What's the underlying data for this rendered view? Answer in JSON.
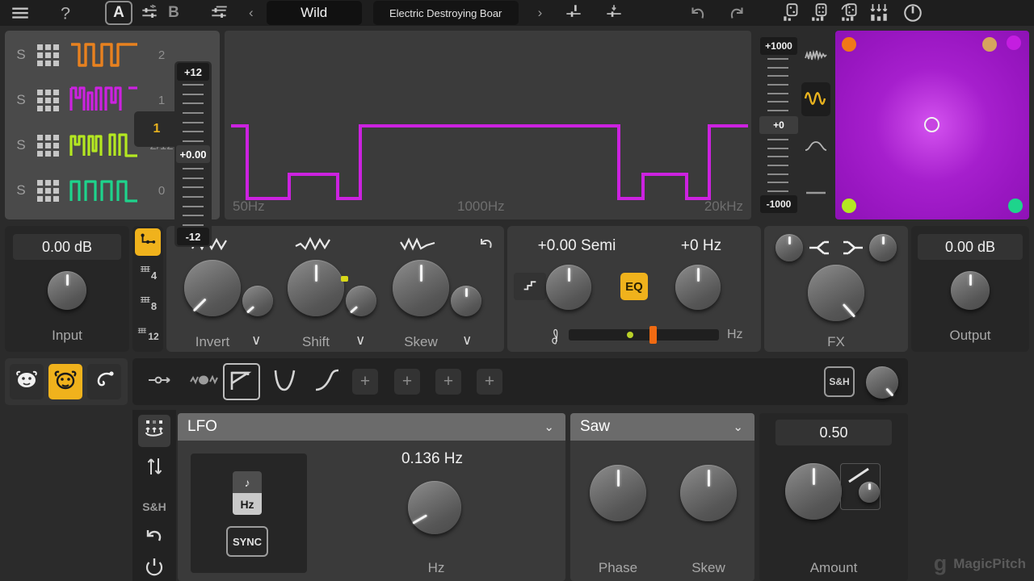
{
  "header": {
    "menu_icon": "hamburger-icon",
    "help_icon": "question-mark-icon",
    "a_label": "A",
    "b_label": "B",
    "copy_a_to_b_icon": "sliders-copy-icon",
    "copy_b_to_a_icon": "sliders-copy-icon",
    "prev_preset_icon": "chevron-left-icon",
    "next_preset_icon": "chevron-right-icon",
    "preset_category": "Wild",
    "preset_name": "Electric Destroying Boar",
    "mixer_icon_1": "sliders-icon",
    "mixer_icon_2": "sliders-icon",
    "undo_icon": "undo-arrow-icon",
    "redo_icon": "redo-arrow-icon",
    "dice_icon_1": "dice-one-icon",
    "dice_icon_2": "dice-two-icon",
    "dice_icon_3": "dice-three-icon",
    "randomize_icon": "down-arrows-icon",
    "power_icon": "power-icon"
  },
  "oscillators": {
    "rows": [
      {
        "solo": "S",
        "grid_icon": "dot-grid-icon",
        "color": "#e8811f",
        "value": "2"
      },
      {
        "solo": "S",
        "grid_icon": "dot-grid-icon",
        "color": "#cc22e0",
        "value": "1"
      },
      {
        "solo": "S",
        "grid_icon": "dot-grid-icon",
        "color": "#b4e821",
        "value": "2/12"
      },
      {
        "solo": "S",
        "grid_icon": "dot-grid-icon",
        "color": "#1ed48c",
        "value": "0"
      }
    ],
    "badge": "1",
    "fader": {
      "top": "+12",
      "value": "+0.00",
      "bottom": "-12"
    }
  },
  "display": {
    "freq_low": "50Hz",
    "freq_mid": "1000Hz",
    "freq_high": "20kHz",
    "curve_color": "#cc22e0"
  },
  "right_fader": {
    "top": "+1000",
    "value": "+0",
    "bottom": "-1000"
  },
  "wave_selector": {
    "items": [
      {
        "icon": "noisy-wave-icon",
        "selected": false
      },
      {
        "icon": "sine-wave-icon",
        "selected": true
      },
      {
        "icon": "smooth-curve-icon",
        "selected": false
      },
      {
        "icon": "flat-line-icon",
        "selected": false
      }
    ]
  },
  "xy_pad": {
    "corners": [
      {
        "name": "top-left-dot",
        "color": "#f07818"
      },
      {
        "name": "top-right-dot",
        "color": "#d6a45e"
      },
      {
        "name": "top-far-right-dot",
        "color": "#c41ee0"
      },
      {
        "name": "bottom-left-dot",
        "color": "#b4e821"
      },
      {
        "name": "bottom-right-dot",
        "color": "#1ed48c"
      }
    ],
    "handle": "xy-handle"
  },
  "input": {
    "value": "0.00 dB",
    "label": "Input"
  },
  "grid_strip": {
    "items": [
      {
        "icon": "step-node-icon",
        "label": "",
        "active": true
      },
      {
        "icon": "grid-icon",
        "label": "4",
        "active": false
      },
      {
        "icon": "grid-icon",
        "label": "8",
        "active": false
      },
      {
        "icon": "grid-icon",
        "label": "12",
        "active": false
      }
    ]
  },
  "shapers": {
    "reset_icon": "reset-arrow-icon",
    "items": [
      {
        "label": "Invert",
        "top_icon": "zigzag-icon",
        "chevron": "∨"
      },
      {
        "label": "Shift",
        "top_icon": "zigzag-shift-icon",
        "chevron": "∨"
      },
      {
        "label": "Skew",
        "top_icon": "zigzag-skew-icon",
        "chevron": "∨"
      }
    ]
  },
  "pitch": {
    "semi_value": "+0.00 Semi",
    "hz_value": "+0 Hz",
    "eq_label": "EQ",
    "step_icon": "stair-step-icon",
    "clef_icon": "treble-clef-icon",
    "hz_label": "Hz"
  },
  "fx": {
    "label": "FX",
    "split_icon": "split-icon",
    "merge_icon": "merge-icon"
  },
  "output": {
    "value": "0.00 dB",
    "label": "Output"
  },
  "creatures": [
    {
      "icon": "cow-face-icon",
      "active": false
    },
    {
      "icon": "bull-face-icon",
      "active": true
    },
    {
      "icon": "horn-icon",
      "active": false
    }
  ],
  "shape_bar": {
    "items": [
      {
        "icon": "line-node-icon",
        "selected": false
      },
      {
        "icon": "noise-blob-icon",
        "selected": false
      },
      {
        "icon": "envelope-step-icon",
        "selected": true
      },
      {
        "icon": "v-shape-icon",
        "selected": false
      },
      {
        "icon": "s-curve-icon",
        "selected": false
      }
    ],
    "add_label": "+",
    "add_count": 4,
    "sh_label": "S&H"
  },
  "mod_strip": [
    {
      "icon": "multi-anchor-icon",
      "label": "",
      "active": true
    },
    {
      "icon": "up-down-arrows-icon",
      "label": "",
      "active": false
    },
    {
      "icon": "",
      "label": "S&H",
      "active": false
    },
    {
      "icon": "undo-arrow-icon",
      "label": "",
      "active": false
    },
    {
      "icon": "power-icon",
      "label": "",
      "active": false
    }
  ],
  "lfo": {
    "title": "LFO",
    "chevron": "⌄",
    "note_icon": "music-note-icon",
    "hz_toggle": "Hz",
    "sync_label": "SYNC",
    "rate_value": "0.136 Hz",
    "rate_label": "Hz"
  },
  "waveform": {
    "title": "Saw",
    "chevron": "⌄",
    "phase_label": "Phase",
    "skew_label": "Skew"
  },
  "amount": {
    "value": "0.50",
    "label": "Amount",
    "curve_icon": "ramp-curve-icon"
  },
  "brand": {
    "logo": "g",
    "name": "MagicPitch"
  }
}
